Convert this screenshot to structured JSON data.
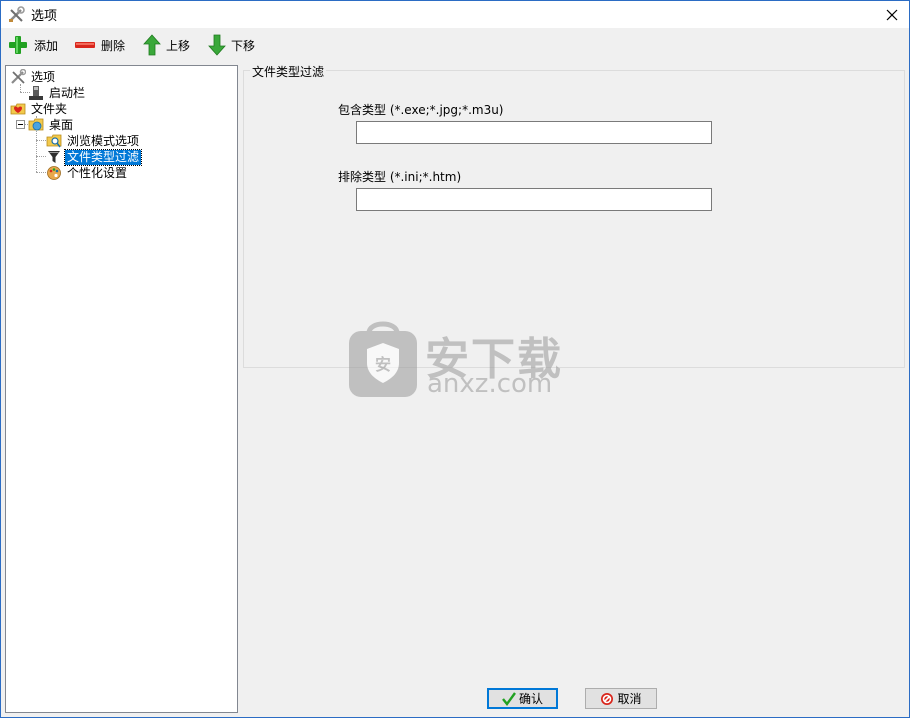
{
  "window": {
    "title": "选项"
  },
  "toolbar": {
    "add": "添加",
    "delete": "删除",
    "move_up": "上移",
    "move_down": "下移"
  },
  "tree": {
    "root": "选项",
    "launch_bar": "启动栏",
    "folders": "文件夹",
    "desktop": "桌面",
    "browse_mode": "浏览模式选项",
    "file_type_filter": "文件类型过滤",
    "personalize": "个性化设置",
    "selected": "文件类型过滤"
  },
  "panel": {
    "group_title": "文件类型过滤",
    "include_label": "包含类型 (*.exe;*.jpg;*.m3u)",
    "include_value": "",
    "exclude_label": "排除类型 (*.ini;*.htm)",
    "exclude_value": ""
  },
  "watermark": {
    "cn": "安下载",
    "en": "anxz.com"
  },
  "buttons": {
    "ok": "确认",
    "cancel": "取消"
  },
  "colors": {
    "selection": "#0078d7",
    "add_green": "#22a122",
    "delete_red": "#d9261c"
  }
}
